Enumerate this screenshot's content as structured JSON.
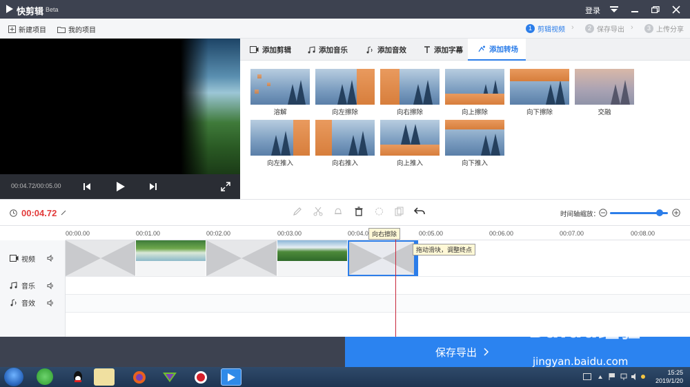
{
  "app": {
    "name": "快剪辑",
    "badge": "Beta",
    "login": "登录"
  },
  "menubar": {
    "new_project": "新建项目",
    "my_projects": "我的项目",
    "steps": [
      {
        "num": "1",
        "label": "剪辑视频",
        "active": true
      },
      {
        "num": "2",
        "label": "保存导出",
        "active": false
      },
      {
        "num": "3",
        "label": "上传分享",
        "active": false
      }
    ]
  },
  "preview": {
    "time": "00:04.72/00:05.00"
  },
  "tabs": [
    {
      "label": "添加剪辑",
      "icon": "video-icon"
    },
    {
      "label": "添加音乐",
      "icon": "music-icon"
    },
    {
      "label": "添加音效",
      "icon": "sound-effect-icon"
    },
    {
      "label": "添加字幕",
      "icon": "text-icon"
    },
    {
      "label": "添加转场",
      "icon": "transition-icon",
      "active": true
    }
  ],
  "transitions": [
    {
      "label": "溶解"
    },
    {
      "label": "向左擦除"
    },
    {
      "label": "向右擦除"
    },
    {
      "label": "向上擦除"
    },
    {
      "label": "向下擦除"
    },
    {
      "label": "交融"
    },
    {
      "label": "向左推入"
    },
    {
      "label": "向右推入"
    },
    {
      "label": "向上推入"
    },
    {
      "label": "向下推入"
    }
  ],
  "timeline": {
    "current_time": "00:04.72",
    "zoom_label": "时间轴缩放：",
    "ruler": [
      "00:00.00",
      "00:01.00",
      "00:02.00",
      "00:03.00",
      "00:04.0",
      "00:05.00",
      "00:06.00",
      "00:07.00",
      "00:08.00"
    ],
    "tracks": [
      {
        "label": "视频",
        "icon": "video-icon"
      },
      {
        "label": "音乐",
        "icon": "music-icon"
      },
      {
        "label": "音效",
        "icon": "sound-effect-icon"
      }
    ],
    "clip_tooltip": "向右擦除",
    "drag_tooltip": "拖动滑块，调整终点"
  },
  "export": {
    "label": "保存导出"
  },
  "taskbar": {
    "clock_time": "15:25",
    "clock_date": "2019/1/20"
  },
  "watermark": {
    "brand": "Baidu经验",
    "url": "jingyan.baidu.com"
  },
  "colors": {
    "accent": "#2b7de9",
    "time_red": "#e23b3b",
    "titlebar": "#3d4250",
    "export_blue": "#2b83f0"
  }
}
